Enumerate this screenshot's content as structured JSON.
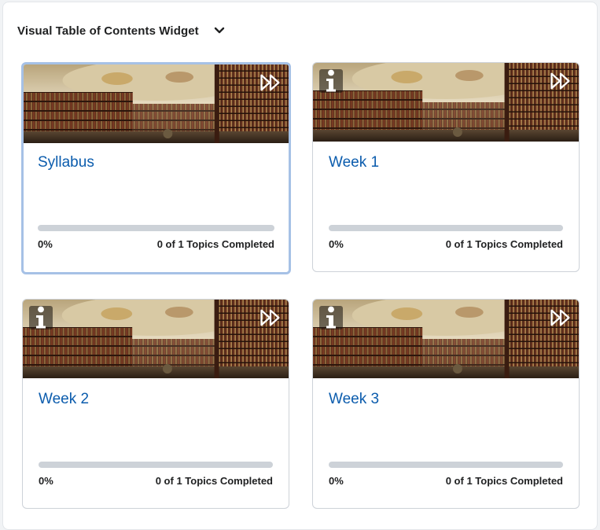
{
  "widget": {
    "title": "Visual Table of Contents Widget",
    "collapse_icon": "chevron-down-icon"
  },
  "colors": {
    "link": "#0b5cad",
    "track": "#cdd2d8",
    "focus_ring": "#a6c1e6"
  },
  "cards": [
    {
      "title": "Syllabus",
      "percent": "0%",
      "progress": 0,
      "topics": "0 of 1 Topics Completed",
      "has_info": false,
      "icons": [
        "skip-forward-icon"
      ]
    },
    {
      "title": "Week 1",
      "percent": "0%",
      "progress": 0,
      "topics": "0 of 1 Topics Completed",
      "has_info": true,
      "icons": [
        "info-icon",
        "skip-forward-icon"
      ]
    },
    {
      "title": "Week 2",
      "percent": "0%",
      "progress": 0,
      "topics": "0 of 1 Topics Completed",
      "has_info": true,
      "icons": [
        "info-icon",
        "skip-forward-icon"
      ]
    },
    {
      "title": "Week 3",
      "percent": "0%",
      "progress": 0,
      "topics": "0 of 1 Topics Completed",
      "has_info": true,
      "icons": [
        "info-icon",
        "skip-forward-icon"
      ]
    }
  ]
}
